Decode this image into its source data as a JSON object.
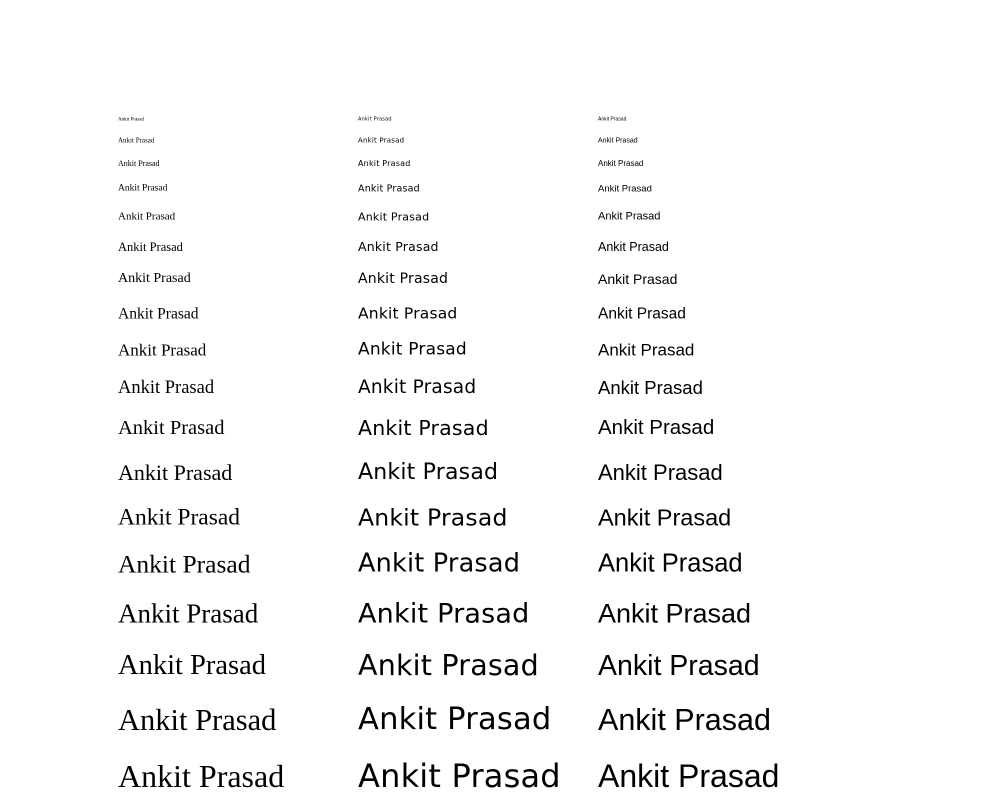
{
  "sample_text": "Ankit Prasad",
  "columns": [
    {
      "name": "serif",
      "rows": 18
    },
    {
      "name": "sans",
      "rows": 18
    },
    {
      "name": "arial",
      "rows": 18
    }
  ]
}
